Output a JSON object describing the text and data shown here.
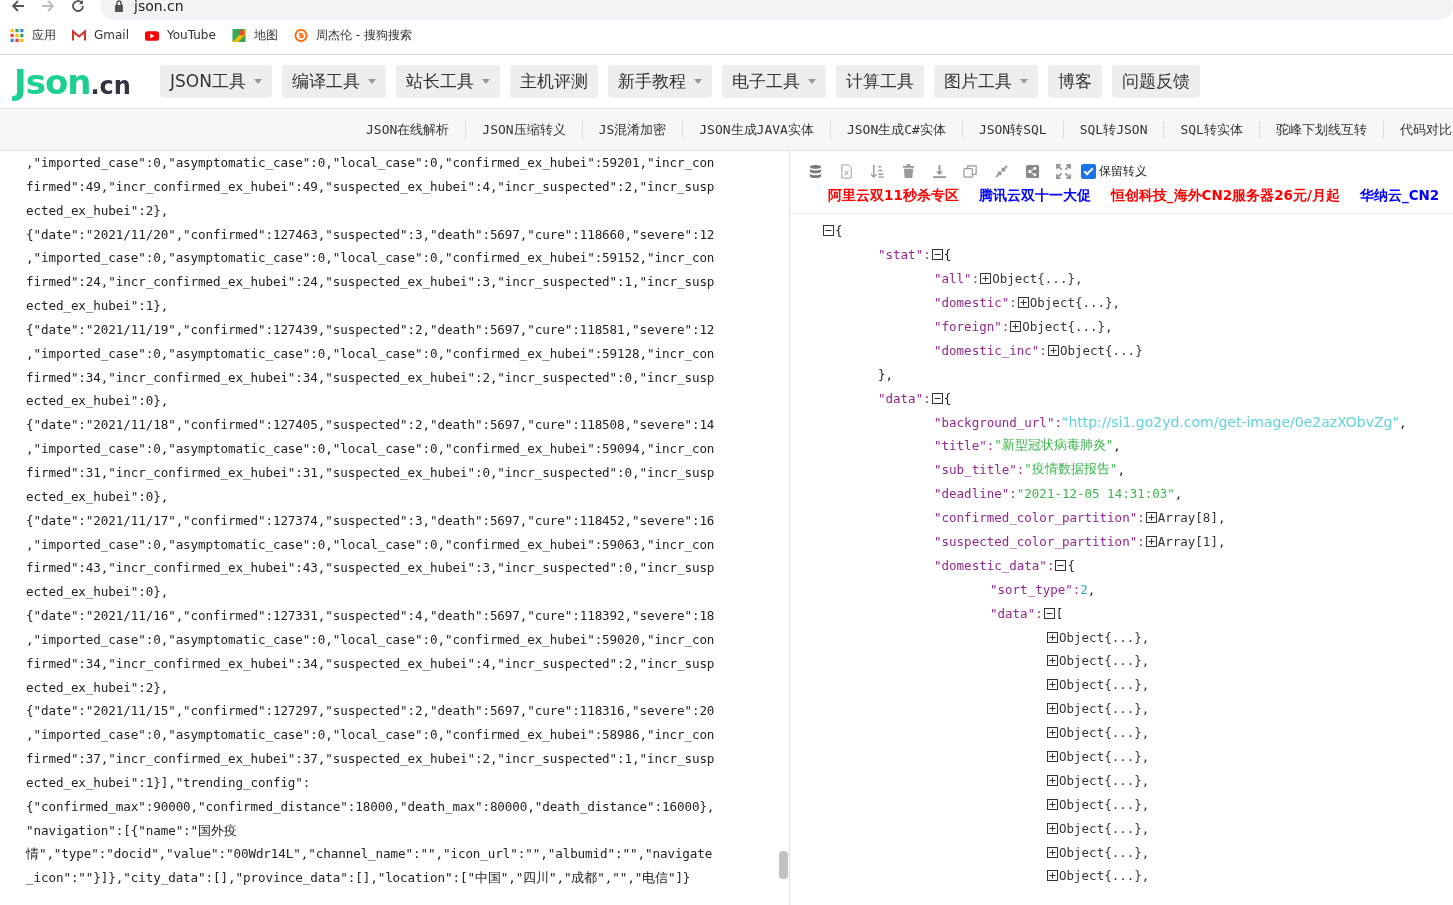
{
  "browser": {
    "address": "json.cn",
    "bookmarks": [
      {
        "label": "应用"
      },
      {
        "label": "Gmail"
      },
      {
        "label": "YouTube"
      },
      {
        "label": "地图"
      },
      {
        "label": "周杰伦 - 搜狗搜索"
      }
    ]
  },
  "logo": {
    "main": "Json",
    "suffix": ".cn"
  },
  "nav": [
    {
      "label": "JSON工具",
      "has_menu": true
    },
    {
      "label": "编译工具",
      "has_menu": true
    },
    {
      "label": "站长工具",
      "has_menu": true
    },
    {
      "label": "主机评测",
      "has_menu": false
    },
    {
      "label": "新手教程",
      "has_menu": true
    },
    {
      "label": "电子工具",
      "has_menu": true
    },
    {
      "label": "计算工具",
      "has_menu": false
    },
    {
      "label": "图片工具",
      "has_menu": true
    },
    {
      "label": "博客",
      "has_menu": false
    },
    {
      "label": "问题反馈",
      "has_menu": false
    }
  ],
  "subnav": [
    "JSON在线解析",
    "JSON压缩转义",
    "JS混淆加密",
    "JSON生成JAVA实体",
    "JSON生成C#实体",
    "JSON转SQL",
    "SQL转JSON",
    "SQL转实体",
    "驼峰下划线互转",
    "代码对比"
  ],
  "editor": {
    "lines": [
      ",\"imported_case\":0,\"asymptomatic_case\":0,\"local_case\":0,\"confirmed_ex_hubei\":59201,\"incr_con",
      "firmed\":49,\"incr_confirmed_ex_hubei\":49,\"suspected_ex_hubei\":4,\"incr_suspected\":2,\"incr_susp",
      "ected_ex_hubei\":2},",
      "{\"date\":\"2021/11/20\",\"confirmed\":127463,\"suspected\":3,\"death\":5697,\"cure\":118660,\"severe\":12",
      ",\"imported_case\":0,\"asymptomatic_case\":0,\"local_case\":0,\"confirmed_ex_hubei\":59152,\"incr_con",
      "firmed\":24,\"incr_confirmed_ex_hubei\":24,\"suspected_ex_hubei\":3,\"incr_suspected\":1,\"incr_susp",
      "ected_ex_hubei\":1},",
      "{\"date\":\"2021/11/19\",\"confirmed\":127439,\"suspected\":2,\"death\":5697,\"cure\":118581,\"severe\":12",
      ",\"imported_case\":0,\"asymptomatic_case\":0,\"local_case\":0,\"confirmed_ex_hubei\":59128,\"incr_con",
      "firmed\":34,\"incr_confirmed_ex_hubei\":34,\"suspected_ex_hubei\":2,\"incr_suspected\":0,\"incr_susp",
      "ected_ex_hubei\":0},",
      "{\"date\":\"2021/11/18\",\"confirmed\":127405,\"suspected\":2,\"death\":5697,\"cure\":118508,\"severe\":14",
      ",\"imported_case\":0,\"asymptomatic_case\":0,\"local_case\":0,\"confirmed_ex_hubei\":59094,\"incr_con",
      "firmed\":31,\"incr_confirmed_ex_hubei\":31,\"suspected_ex_hubei\":0,\"incr_suspected\":0,\"incr_susp",
      "ected_ex_hubei\":0},",
      "{\"date\":\"2021/11/17\",\"confirmed\":127374,\"suspected\":3,\"death\":5697,\"cure\":118452,\"severe\":16",
      ",\"imported_case\":0,\"asymptomatic_case\":0,\"local_case\":0,\"confirmed_ex_hubei\":59063,\"incr_con",
      "firmed\":43,\"incr_confirmed_ex_hubei\":43,\"suspected_ex_hubei\":3,\"incr_suspected\":0,\"incr_susp",
      "ected_ex_hubei\":0},",
      "{\"date\":\"2021/11/16\",\"confirmed\":127331,\"suspected\":4,\"death\":5697,\"cure\":118392,\"severe\":18",
      ",\"imported_case\":0,\"asymptomatic_case\":0,\"local_case\":0,\"confirmed_ex_hubei\":59020,\"incr_con",
      "firmed\":34,\"incr_confirmed_ex_hubei\":34,\"suspected_ex_hubei\":4,\"incr_suspected\":2,\"incr_susp",
      "ected_ex_hubei\":2},",
      "{\"date\":\"2021/11/15\",\"confirmed\":127297,\"suspected\":2,\"death\":5697,\"cure\":118316,\"severe\":20",
      ",\"imported_case\":0,\"asymptomatic_case\":0,\"local_case\":0,\"confirmed_ex_hubei\":58986,\"incr_con",
      "firmed\":37,\"incr_confirmed_ex_hubei\":37,\"suspected_ex_hubei\":2,\"incr_suspected\":1,\"incr_susp",
      "ected_ex_hubei\":1}],\"trending_config\":",
      "{\"confirmed_max\":90000,\"confirmed_distance\":18000,\"death_max\":80000,\"death_distance\":16000},",
      "\"navigation\":[{\"name\":\"国外疫",
      "情\",\"type\":\"docid\",\"value\":\"00Wdr14L\",\"channel_name\":\"\",\"icon_url\":\"\",\"albumid\":\"\",\"navigate",
      "_icon\":\"\"}]},\"city_data\":[],\"province_data\":[],\"location\":[\"中国\",\"四川\",\"成都\",\"\",\"电信\"]}"
    ]
  },
  "viewer": {
    "keep_escape": {
      "label": "保留转义",
      "checked": true
    },
    "ads": [
      {
        "label": "阿里云双11秒杀专区",
        "color": "#ff0000"
      },
      {
        "label": "腾讯云双十一大促",
        "color": "#0000ff"
      },
      {
        "label": "恒创科技_海外CN2服务器26元/月起",
        "color": "#ff0000"
      },
      {
        "label": "华纳云_CN2",
        "color": "#0000ff"
      }
    ],
    "tree": {
      "kind": "object",
      "expanded": true,
      "open": "{",
      "children": [
        {
          "key": "\"stat\":",
          "kind": "object",
          "expanded": true,
          "open": "{",
          "close": "},",
          "children": [
            {
              "key": "\"all\":",
              "kind": "object",
              "expanded": false,
              "value": "Object{...},"
            },
            {
              "key": "\"domestic\":",
              "kind": "object",
              "expanded": false,
              "value": "Object{...},"
            },
            {
              "key": "\"foreign\":",
              "kind": "object",
              "expanded": false,
              "value": "Object{...},"
            },
            {
              "key": "\"domestic_inc\":",
              "kind": "object",
              "expanded": false,
              "value": "Object{...}"
            }
          ]
        },
        {
          "key": "\"data\":",
          "kind": "object",
          "expanded": true,
          "open": "{",
          "children": [
            {
              "key": "\"background_url\":",
              "kind": "url",
              "value": "\"http://si1.go2yd.com/get-image/0e2azXObvZg\"",
              "tail": ","
            },
            {
              "key": "\"title\":",
              "kind": "string",
              "value": "\"新型冠状病毒肺炎\"",
              "tail": ","
            },
            {
              "key": "\"sub_title\":",
              "kind": "string",
              "value": "\"疫情数据报告\"",
              "tail": ","
            },
            {
              "key": "\"deadline\":",
              "kind": "string",
              "value": "\"2021-12-05  14:31:03\"",
              "tail": ","
            },
            {
              "key": "\"confirmed_color_partition\":",
              "kind": "object",
              "expanded": false,
              "value": "Array[8],"
            },
            {
              "key": "\"suspected_color_partition\":",
              "kind": "object",
              "expanded": false,
              "value": "Array[1],"
            },
            {
              "key": "\"domestic_data\":",
              "kind": "object",
              "expanded": true,
              "open": "{",
              "children": [
                {
                  "key": "\"sort_type\":",
                  "kind": "number",
                  "value": "2",
                  "tail": ","
                },
                {
                  "key": "\"data\":",
                  "kind": "object",
                  "expanded": true,
                  "open": "[",
                  "children": [
                    {
                      "kind": "object",
                      "expanded": false,
                      "value": "Object{...},"
                    },
                    {
                      "kind": "object",
                      "expanded": false,
                      "value": "Object{...},"
                    },
                    {
                      "kind": "object",
                      "expanded": false,
                      "value": "Object{...},"
                    },
                    {
                      "kind": "object",
                      "expanded": false,
                      "value": "Object{...},"
                    },
                    {
                      "kind": "object",
                      "expanded": false,
                      "value": "Object{...},"
                    },
                    {
                      "kind": "object",
                      "expanded": false,
                      "value": "Object{...},"
                    },
                    {
                      "kind": "object",
                      "expanded": false,
                      "value": "Object{...},"
                    },
                    {
                      "kind": "object",
                      "expanded": false,
                      "value": "Object{...},"
                    },
                    {
                      "kind": "object",
                      "expanded": false,
                      "value": "Object{...},"
                    },
                    {
                      "kind": "object",
                      "expanded": false,
                      "value": "Object{...},"
                    },
                    {
                      "kind": "object",
                      "expanded": false,
                      "value": "Object{...},"
                    }
                  ]
                }
              ]
            }
          ]
        }
      ]
    }
  }
}
